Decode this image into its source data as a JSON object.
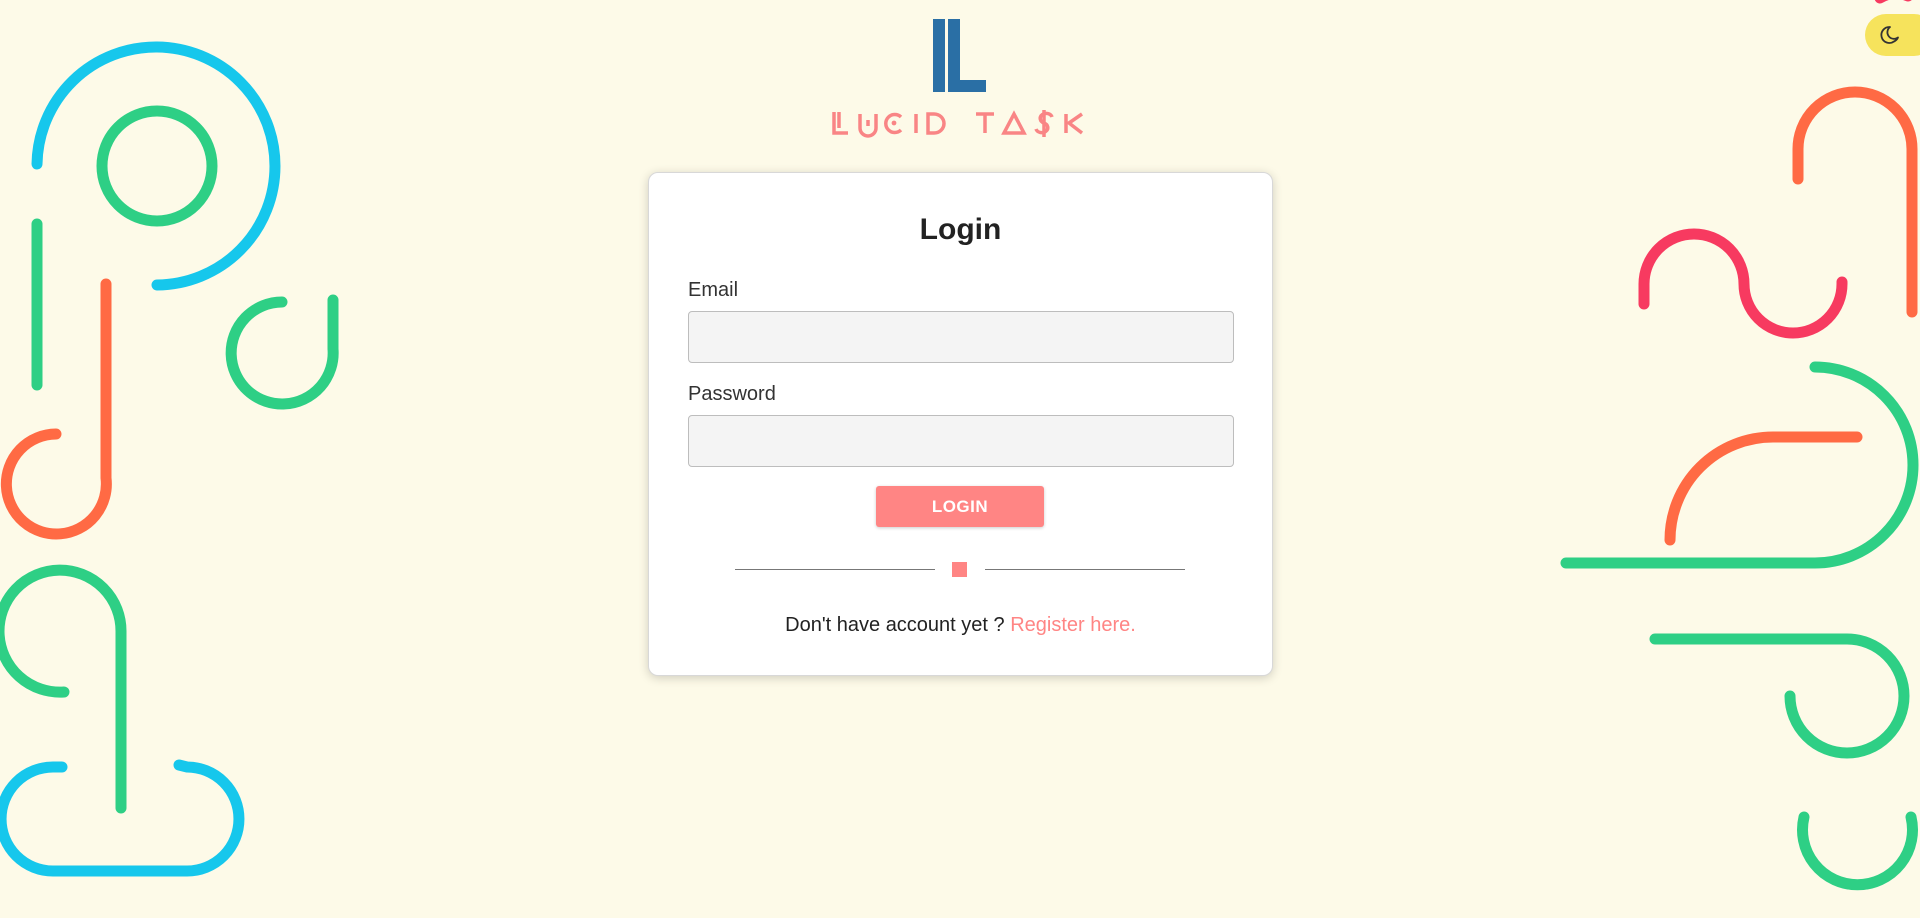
{
  "brand": {
    "name": "LUCID TA$K",
    "colors": {
      "logo_mark": "#2a6fa5",
      "logo_text": "#f98585"
    }
  },
  "theme_toggle": {
    "icon": "moon-icon",
    "color": "#f6e35c"
  },
  "login_form": {
    "title": "Login",
    "email_label": "Email",
    "email_value": "",
    "password_label": "Password",
    "password_value": "",
    "submit_label": "LOGIN",
    "register_prompt": "Don't have account yet ?",
    "register_link": "Register here."
  },
  "colors": {
    "background": "#fdfae8",
    "accent": "#ff8584",
    "deco_green": "#2ecf85",
    "deco_cyan": "#16c7ec",
    "deco_orange": "#ff6a44",
    "deco_red": "#f73a60"
  }
}
